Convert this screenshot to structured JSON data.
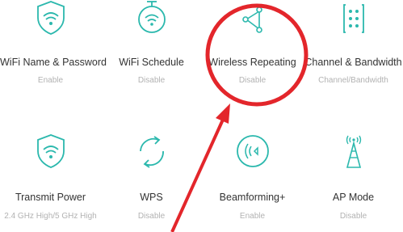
{
  "colors": {
    "accent": "#2bb8ad",
    "annotation": "#e3262b"
  },
  "tiles": [
    {
      "title": "WiFi Name & Password",
      "sub": "Enable",
      "icon": "wifi-shield-icon"
    },
    {
      "title": "WiFi Schedule",
      "sub": "Disable",
      "icon": "wifi-schedule-icon"
    },
    {
      "title": "Wireless Repeating",
      "sub": "Disable",
      "icon": "repeater-icon"
    },
    {
      "title": "Channel & Bandwidth",
      "sub": "Channel/Bandwidth",
      "icon": "channel-bandwidth-icon"
    },
    {
      "title": "Transmit Power",
      "sub": "2.4 GHz High/5 GHz High",
      "icon": "transmit-power-icon"
    },
    {
      "title": "WPS",
      "sub": "Disable",
      "icon": "wps-icon"
    },
    {
      "title": "Beamforming+",
      "sub": "Enable",
      "icon": "beamforming-icon"
    },
    {
      "title": "AP Mode",
      "sub": "Disable",
      "icon": "ap-mode-icon"
    }
  ]
}
